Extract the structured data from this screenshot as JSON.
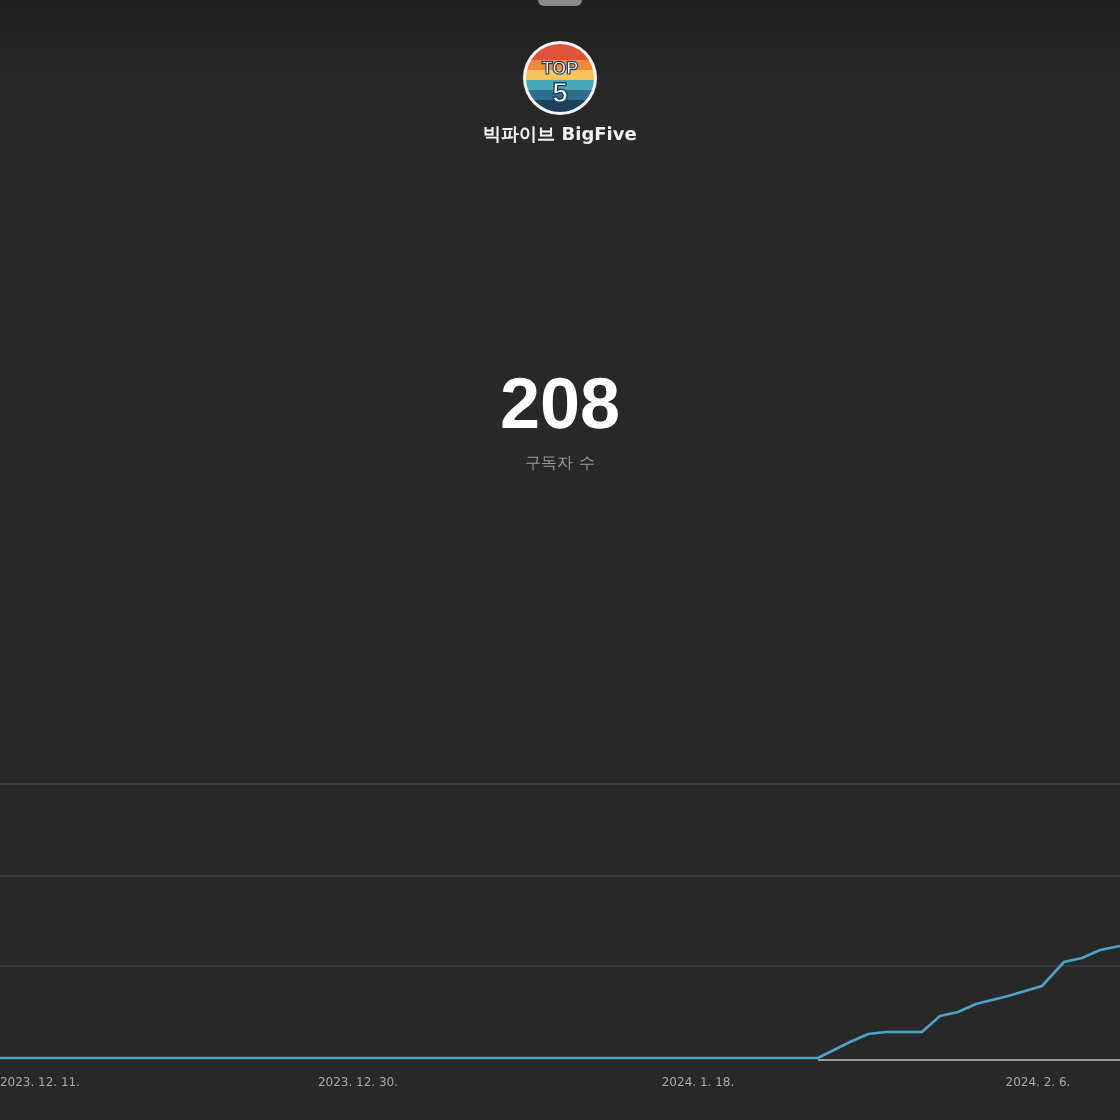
{
  "channel": {
    "logo_text": [
      "TOP",
      "5"
    ],
    "name": "빅파이브 BigFive"
  },
  "subscribers": {
    "count": "208",
    "label": "구독자 수"
  },
  "chart": {
    "x_labels": [
      "2023. 12. 11.",
      "2023. 12. 30.",
      "2024. 1. 18.",
      "2024. 2. 6."
    ]
  }
}
